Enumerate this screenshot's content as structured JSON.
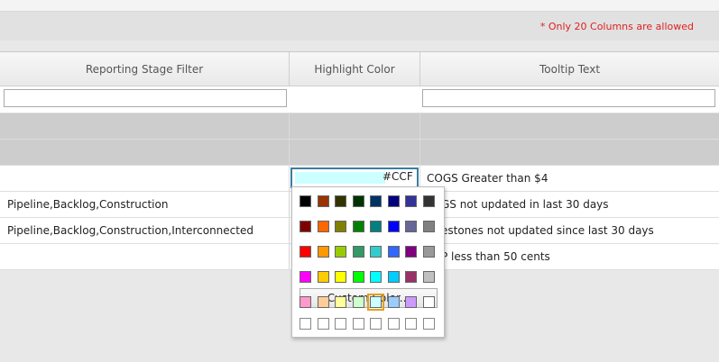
{
  "notice": "* Only 20 Columns are allowed",
  "columns": [
    "Reporting Stage Filter",
    "Highlight Color",
    "Tooltip Text"
  ],
  "filters": {
    "col1": "",
    "col3": ""
  },
  "rows": [
    {
      "stage": "",
      "tooltip": "COGS Greater than $4"
    },
    {
      "stage": "Pipeline,Backlog,Construction",
      "tooltip": "GS not updated in last 30 days"
    },
    {
      "stage": "Pipeline,Backlog,Construction,Interconnected",
      "tooltip": "estones not updated since last 30 days"
    },
    {
      "stage": "",
      "tooltip": "P less than 50 cents"
    }
  ],
  "color_input": {
    "value": "#CCF",
    "fill": "#ccffff"
  },
  "picker": {
    "custom_label": "Custom Color...",
    "palette": [
      [
        "#000000",
        "#993300",
        "#333300",
        "#003300",
        "#003366",
        "#000080",
        "#333399",
        "#333333"
      ],
      [
        "#800000",
        "#ff6600",
        "#808000",
        "#008000",
        "#008080",
        "#0000ff",
        "#666699",
        "#808080"
      ],
      [
        "#ff0000",
        "#ff9900",
        "#99cc00",
        "#339966",
        "#33cccc",
        "#3366ff",
        "#800080",
        "#999999"
      ],
      [
        "#ff00ff",
        "#ffcc00",
        "#ffff00",
        "#00ff00",
        "#00ffff",
        "#00ccff",
        "#993366",
        "#c0c0c0"
      ],
      [
        "#ff99cc",
        "#ffcc99",
        "#ffff99",
        "#ccffcc",
        "#ccffff",
        "#99ccff",
        "#cc99ff",
        "#ffffff"
      ]
    ],
    "selected": [
      4,
      4
    ],
    "custom_slots": 8
  }
}
